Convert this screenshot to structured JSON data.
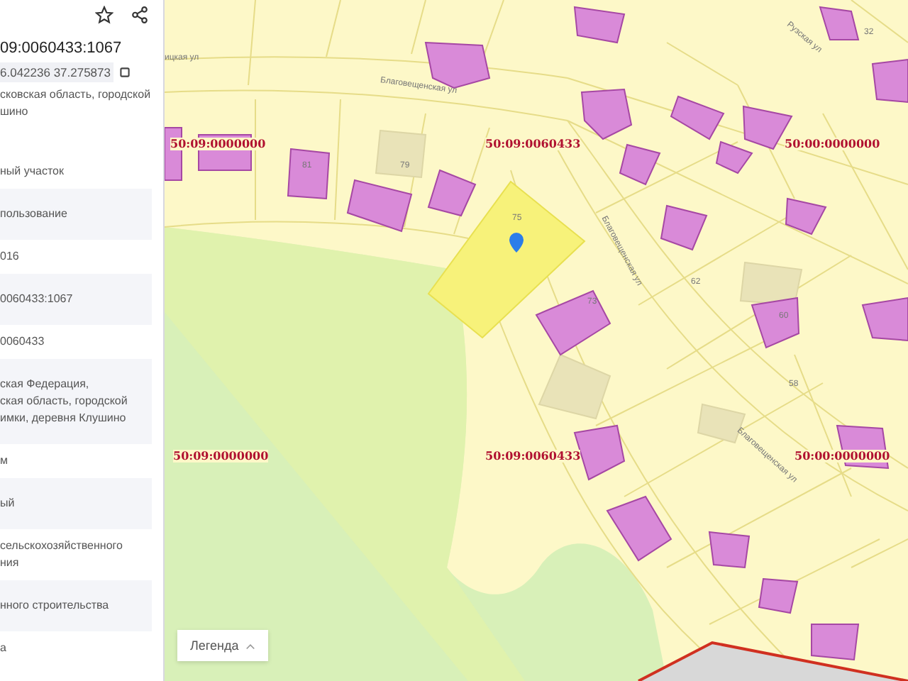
{
  "header": {
    "title": "09:0060433:1067",
    "coordinates": "6.042236 37.275873",
    "address": [
      "сковская область, городской",
      "шино"
    ]
  },
  "details": [
    {
      "lines": [
        "ный участок"
      ]
    },
    {
      "lines": [
        "пользование"
      ]
    },
    {
      "lines": [
        "016"
      ]
    },
    {
      "lines": [
        "0060433:1067"
      ]
    },
    {
      "lines": [
        "0060433"
      ]
    },
    {
      "lines": [
        "ская Федерация,",
        "ская область, городской",
        "имки, деревня Клушино"
      ]
    },
    {
      "lines": [
        "м"
      ]
    },
    {
      "lines": [
        "ый"
      ]
    },
    {
      "lines": [
        "сельскохозяйственного",
        "ния"
      ]
    },
    {
      "lines": [
        "нного строительства"
      ]
    },
    {
      "lines": [
        "а"
      ]
    }
  ],
  "map": {
    "cadastral_labels": [
      "50:09:0000000",
      "50:09:0060433",
      "50:00:0000000",
      "50:09:0000000",
      "50:09:0060433",
      "50:00:0000000"
    ],
    "street_labels": [
      "ицкая ул",
      "Благовещенская ул",
      "Рузская ул",
      "Благовещенская ул",
      "Благовещенская ул"
    ],
    "plot_numbers": [
      "81",
      "79",
      "75",
      "73",
      "62",
      "60",
      "58",
      "32"
    ],
    "legend_button": "Легенда"
  }
}
